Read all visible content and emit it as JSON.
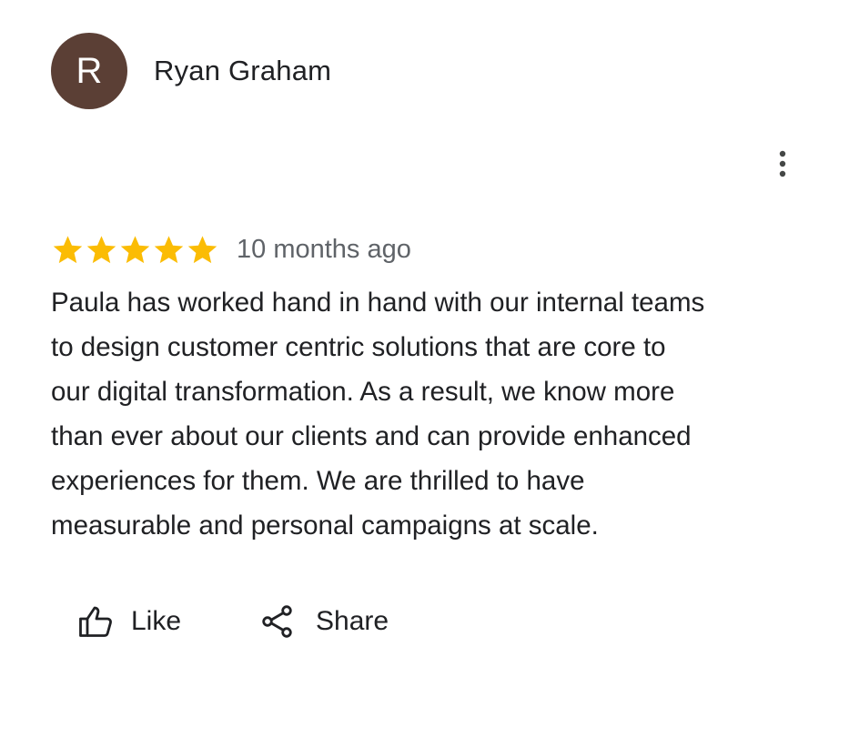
{
  "review": {
    "avatar_initial": "R",
    "author_name": "Ryan Graham",
    "rating": 5,
    "rating_max": 5,
    "age": "10 months ago",
    "text": "Paula has worked hand in hand with our internal teams\nto design customer centric solutions that are core to\nour digital transformation. As a result, we know more\nthan ever about our clients and can provide enhanced\nexperiences for them. We are thrilled to have\nmeasurable and personal campaigns at scale."
  },
  "actions": {
    "like_label": "Like",
    "share_label": "Share"
  },
  "icons": {
    "more": "more-vert-icon",
    "star": "star-icon",
    "like": "thumb-up-icon",
    "share": "share-icon"
  },
  "colors": {
    "avatar_bg": "#5b3f35",
    "star": "#fbbc04",
    "secondary_text": "#5f6368",
    "primary_text": "#202124"
  }
}
